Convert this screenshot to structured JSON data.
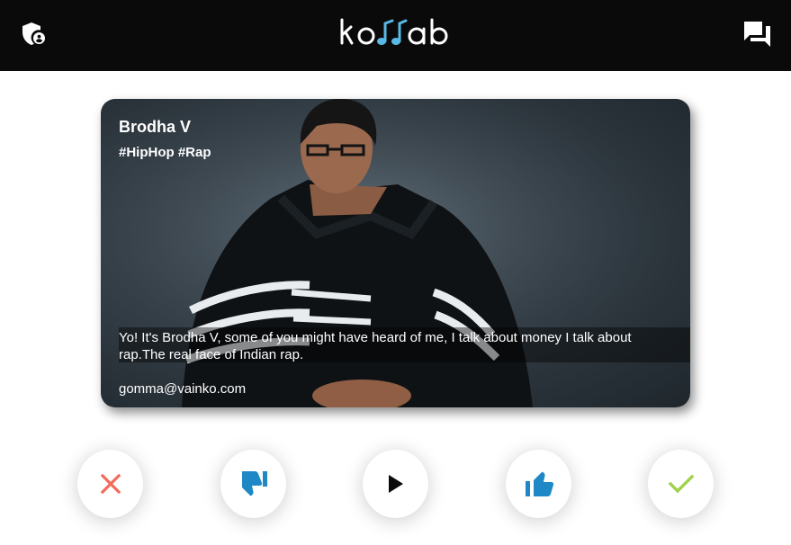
{
  "header": {
    "logo_text": "kollab",
    "admin_icon": "admin-shield-user-icon",
    "chat_icon": "forum-chat-icon"
  },
  "card": {
    "artist_name": "Brodha V",
    "tags": "#HipHop #Rap",
    "bio": "Yo! It's Brodha V, some of you might have heard of me, I talk about money I talk about rap.The real face of Indian rap.",
    "email": "gomma@vainko.com"
  },
  "actions": [
    {
      "name": "reject",
      "icon": "close-icon",
      "color": "#f26b5b"
    },
    {
      "name": "dislike",
      "icon": "thumbs-down-icon",
      "color": "#1e88c7"
    },
    {
      "name": "play",
      "icon": "play-icon",
      "color": "#0a0a0a"
    },
    {
      "name": "like",
      "icon": "thumbs-up-icon",
      "color": "#1e88c7"
    },
    {
      "name": "accept",
      "icon": "check-icon",
      "color": "#9fd24a"
    }
  ],
  "colors": {
    "topbar": "#0a0a0a",
    "logo_accent": "#5ab8e6"
  }
}
